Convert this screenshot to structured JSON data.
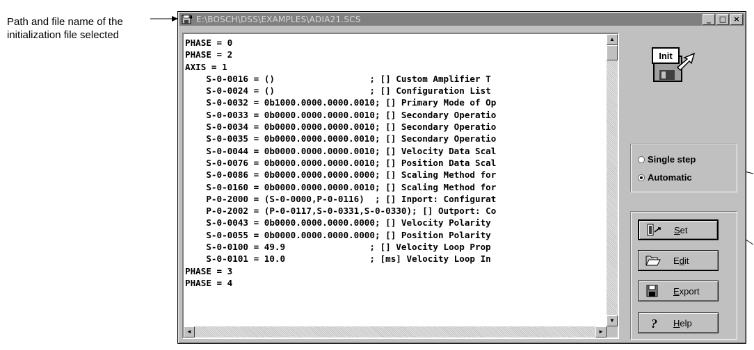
{
  "annotation": {
    "caption": "Path and file name of the initialization file selected"
  },
  "window": {
    "title": "E:\\BOSCH\\DSS\\EXAMPLES\\ADIA21.SCS",
    "controls": {
      "minimize": "_",
      "maximize": "□",
      "close": "×"
    }
  },
  "code_lines": [
    "PHASE = 0",
    "PHASE = 2",
    "AXIS = 1",
    "    S-0-0016 = ()                  ; [] Custom Amplifier T",
    "    S-0-0024 = ()                  ; [] Configuration List",
    "    S-0-0032 = 0b1000.0000.0000.0010; [] Primary Mode of Op",
    "    S-0-0033 = 0b0000.0000.0000.0010; [] Secondary Operatio",
    "    S-0-0034 = 0b0000.0000.0000.0010; [] Secondary Operatio",
    "    S-0-0035 = 0b0000.0000.0000.0010; [] Secondary Operatio",
    "    S-0-0044 = 0b0000.0000.0000.0010; [] Velocity Data Scal",
    "    S-0-0076 = 0b0000.0000.0000.0010; [] Position Data Scal",
    "    S-0-0086 = 0b0000.0000.0000.0000; [] Scaling Method for",
    "    S-0-0160 = 0b0000.0000.0000.0010; [] Scaling Method for",
    "    P-0-2000 = (S-0-0000,P-0-0116)  ; [] Inport: Configurat",
    "    P-0-2002 = (P-0-0117,S-0-0331,S-0-0330); [] Outport: Co",
    "    S-0-0043 = 0b0000.0000.0000.0000; [] Velocity Polarity ",
    "    S-0-0055 = 0b0000.0000.0000.0000; [] Position Polarity ",
    "    S-0-0100 = 49.9                ; [] Velocity Loop Prop",
    "    S-0-0101 = 10.0                ; [ms] Velocity Loop In",
    "PHASE = 3",
    "PHASE = 4"
  ],
  "scrollbars": {
    "up": "▲",
    "down": "▼",
    "left": "◄",
    "right": "►"
  },
  "icons": {
    "init_icon_label": "Init",
    "app_icon": "floppy-disk-icon"
  },
  "mode": {
    "single_step_label": "Single step",
    "automatic_label": "Automatic",
    "selected": "automatic"
  },
  "buttons": {
    "set": {
      "pre": "",
      "ul": "S",
      "post": "et"
    },
    "edit": {
      "pre": "E",
      "ul": "d",
      "post": "it"
    },
    "export": {
      "pre": "",
      "ul": "E",
      "post": "xport"
    },
    "help": {
      "pre": "",
      "ul": "H",
      "post": "elp"
    }
  }
}
